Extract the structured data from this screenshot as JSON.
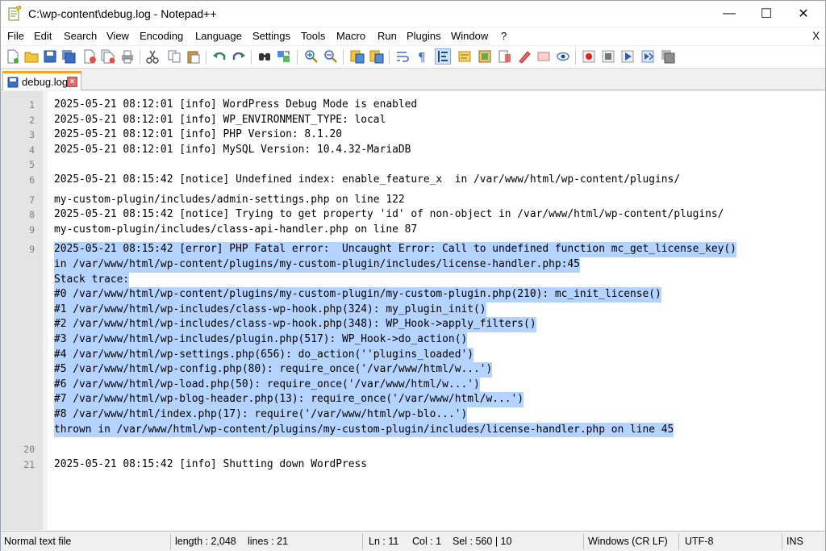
{
  "window": {
    "title": "C:\\wp-content\\debug.log - Notepad++",
    "minimize_glyph": "—",
    "maximize_glyph": "☐",
    "close_glyph": "✕"
  },
  "menu": {
    "items": [
      "File",
      "Edit",
      "Search",
      "View",
      "Encoding",
      "Language",
      "Settings",
      "Tools",
      "Macro",
      "Run",
      "Plugins",
      "Window",
      "?"
    ],
    "close_glyph": "X"
  },
  "toolbar": {
    "icons": [
      "new-file-icon",
      "open-file-icon",
      "save-icon",
      "save-all-icon",
      "close-icon",
      "close-all-icon",
      "print-icon",
      "cut-icon",
      "copy-icon",
      "paste-icon",
      "undo-icon",
      "redo-icon",
      "find-icon",
      "replace-icon",
      "zoom-in-icon",
      "zoom-out-icon",
      "sync-vertical-icon",
      "sync-horizontal-icon",
      "word-wrap-icon",
      "show-all-chars-icon",
      "indent-guide-icon",
      "udl-icon",
      "doc-map-icon",
      "function-list-icon",
      "folder-workspace-icon",
      "monitoring-icon",
      "record-macro-icon",
      "stop-record-icon",
      "play-macro-icon",
      "run-macro-multiple-icon",
      "save-macro-icon"
    ]
  },
  "tab": {
    "label": "debug.log",
    "close_glyph": "×"
  },
  "editor": {
    "lines": [
      {
        "num": "1",
        "text": "2025-05-21 08:12:01 [info] WordPress Debug Mode is enabled",
        "selected": false
      },
      {
        "num": "2",
        "text": "2025-05-21 08:12:01 [info] WP_ENVIRONMENT_TYPE: local",
        "selected": false
      },
      {
        "num": "3",
        "text": "2025-05-21 08:12:01 [info] PHP Version: 8.1.20",
        "selected": false
      },
      {
        "num": "4",
        "text": "2025-05-21 08:12:01 [info] MySQL Version: 10.4.32-MariaDB",
        "selected": false
      },
      {
        "num": "5",
        "text": "",
        "selected": false
      },
      {
        "num": "6",
        "text": "2025-05-21 08:15:42 [notice] Undefined index: enable_feature_x  in /var/www/html/wp-content/plugins/",
        "selected": false
      },
      {
        "num": "7",
        "text": "my-custom-plugin/includes/admin-settings.php on line 122",
        "selected": false
      },
      {
        "num": "8",
        "text": "2025-05-21 08:15:42 [notice] Trying to get property 'id' of non-object in /var/www/html/wp-content/plugins/",
        "selected": false
      },
      {
        "num": "9",
        "text": "my-custom-plugin/includes/class-api-handler.php on line 87",
        "selected": false
      },
      {
        "num": "9",
        "text": "2025-05-21 08:15:42 [error] PHP Fatal error:  Uncaught Error: Call to undefined function mc_get_license_key()",
        "selected": true
      },
      {
        "num": "",
        "text": "in /var/www/html/wp-content/plugins/my-custom-plugin/includes/license-handler.php:45",
        "selected": true
      },
      {
        "num": "",
        "text": "Stack trace:",
        "selected": true
      },
      {
        "num": "",
        "text": "#0 /var/www/html/wp-content/plugins/my-custom-plugin/my-custom-plugin.php(210): mc_init_license()",
        "selected": true
      },
      {
        "num": "",
        "text": "#1 /var/www/html/wp-includes/class-wp-hook.php(324): my_plugin_init()",
        "selected": true
      },
      {
        "num": "",
        "text": "#2 /var/www/html/wp-includes/class-wp-hook.php(348): WP_Hook->apply_filters()",
        "selected": true
      },
      {
        "num": "",
        "text": "#3 /var/www/html/wp-includes/plugin.php(517): WP_Hook->do_action()",
        "selected": true
      },
      {
        "num": "",
        "text": "#4 /var/www/html/wp-settings.php(656): do_action(''plugins_loaded')",
        "selected": true
      },
      {
        "num": "",
        "text": "#5 /var/www/html/wp-config.php(80): require_once('/var/www/html/w...')",
        "selected": true
      },
      {
        "num": "",
        "text": "#6 /var/www/html/wp-load.php(50): require_once('/var/www/html/w...')",
        "selected": true
      },
      {
        "num": "",
        "text": "#7 /var/www/html/wp-blog-header.php(13): require_once('/var/www/html/w...')",
        "selected": true
      },
      {
        "num": "",
        "text": "#8 /var/www/html/index.php(17): require('/var/www/html/wp-blo...')",
        "selected": true
      },
      {
        "num": "",
        "text": "thrown in /var/www/html/wp-content/plugins/my-custom-plugin/includes/license-handler.php on line 45",
        "selected": true
      },
      {
        "num": "20",
        "text": "",
        "selected": false
      },
      {
        "num": "21",
        "text": "2025-05-21 08:15:42 [info] Shutting down WordPress",
        "selected": false
      }
    ]
  },
  "status": {
    "file_type": "Normal text file",
    "length": "length : 2,048",
    "lines": "lines : 21",
    "ln": "Ln : 11",
    "col": "Col : 1",
    "sel": "Sel : 560 | 10",
    "eol": "Windows (CR LF)",
    "encoding": "UTF-8",
    "mode": "INS"
  },
  "colors": {
    "selection": "#b5d3ff",
    "gutter": "#e4e4e4",
    "line_number": "#808080",
    "tab_accent": "#f4a623"
  }
}
